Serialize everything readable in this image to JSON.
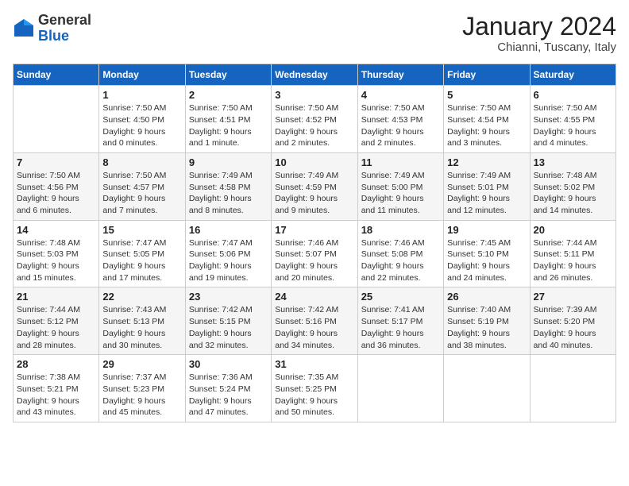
{
  "logo": {
    "general": "General",
    "blue": "Blue"
  },
  "header": {
    "month": "January 2024",
    "location": "Chianni, Tuscany, Italy"
  },
  "weekdays": [
    "Sunday",
    "Monday",
    "Tuesday",
    "Wednesday",
    "Thursday",
    "Friday",
    "Saturday"
  ],
  "weeks": [
    [
      {
        "day": "",
        "info": ""
      },
      {
        "day": "1",
        "info": "Sunrise: 7:50 AM\nSunset: 4:50 PM\nDaylight: 9 hours\nand 0 minutes."
      },
      {
        "day": "2",
        "info": "Sunrise: 7:50 AM\nSunset: 4:51 PM\nDaylight: 9 hours\nand 1 minute."
      },
      {
        "day": "3",
        "info": "Sunrise: 7:50 AM\nSunset: 4:52 PM\nDaylight: 9 hours\nand 2 minutes."
      },
      {
        "day": "4",
        "info": "Sunrise: 7:50 AM\nSunset: 4:53 PM\nDaylight: 9 hours\nand 2 minutes."
      },
      {
        "day": "5",
        "info": "Sunrise: 7:50 AM\nSunset: 4:54 PM\nDaylight: 9 hours\nand 3 minutes."
      },
      {
        "day": "6",
        "info": "Sunrise: 7:50 AM\nSunset: 4:55 PM\nDaylight: 9 hours\nand 4 minutes."
      }
    ],
    [
      {
        "day": "7",
        "info": "Sunrise: 7:50 AM\nSunset: 4:56 PM\nDaylight: 9 hours\nand 6 minutes."
      },
      {
        "day": "8",
        "info": "Sunrise: 7:50 AM\nSunset: 4:57 PM\nDaylight: 9 hours\nand 7 minutes."
      },
      {
        "day": "9",
        "info": "Sunrise: 7:49 AM\nSunset: 4:58 PM\nDaylight: 9 hours\nand 8 minutes."
      },
      {
        "day": "10",
        "info": "Sunrise: 7:49 AM\nSunset: 4:59 PM\nDaylight: 9 hours\nand 9 minutes."
      },
      {
        "day": "11",
        "info": "Sunrise: 7:49 AM\nSunset: 5:00 PM\nDaylight: 9 hours\nand 11 minutes."
      },
      {
        "day": "12",
        "info": "Sunrise: 7:49 AM\nSunset: 5:01 PM\nDaylight: 9 hours\nand 12 minutes."
      },
      {
        "day": "13",
        "info": "Sunrise: 7:48 AM\nSunset: 5:02 PM\nDaylight: 9 hours\nand 14 minutes."
      }
    ],
    [
      {
        "day": "14",
        "info": "Sunrise: 7:48 AM\nSunset: 5:03 PM\nDaylight: 9 hours\nand 15 minutes."
      },
      {
        "day": "15",
        "info": "Sunrise: 7:47 AM\nSunset: 5:05 PM\nDaylight: 9 hours\nand 17 minutes."
      },
      {
        "day": "16",
        "info": "Sunrise: 7:47 AM\nSunset: 5:06 PM\nDaylight: 9 hours\nand 19 minutes."
      },
      {
        "day": "17",
        "info": "Sunrise: 7:46 AM\nSunset: 5:07 PM\nDaylight: 9 hours\nand 20 minutes."
      },
      {
        "day": "18",
        "info": "Sunrise: 7:46 AM\nSunset: 5:08 PM\nDaylight: 9 hours\nand 22 minutes."
      },
      {
        "day": "19",
        "info": "Sunrise: 7:45 AM\nSunset: 5:10 PM\nDaylight: 9 hours\nand 24 minutes."
      },
      {
        "day": "20",
        "info": "Sunrise: 7:44 AM\nSunset: 5:11 PM\nDaylight: 9 hours\nand 26 minutes."
      }
    ],
    [
      {
        "day": "21",
        "info": "Sunrise: 7:44 AM\nSunset: 5:12 PM\nDaylight: 9 hours\nand 28 minutes."
      },
      {
        "day": "22",
        "info": "Sunrise: 7:43 AM\nSunset: 5:13 PM\nDaylight: 9 hours\nand 30 minutes."
      },
      {
        "day": "23",
        "info": "Sunrise: 7:42 AM\nSunset: 5:15 PM\nDaylight: 9 hours\nand 32 minutes."
      },
      {
        "day": "24",
        "info": "Sunrise: 7:42 AM\nSunset: 5:16 PM\nDaylight: 9 hours\nand 34 minutes."
      },
      {
        "day": "25",
        "info": "Sunrise: 7:41 AM\nSunset: 5:17 PM\nDaylight: 9 hours\nand 36 minutes."
      },
      {
        "day": "26",
        "info": "Sunrise: 7:40 AM\nSunset: 5:19 PM\nDaylight: 9 hours\nand 38 minutes."
      },
      {
        "day": "27",
        "info": "Sunrise: 7:39 AM\nSunset: 5:20 PM\nDaylight: 9 hours\nand 40 minutes."
      }
    ],
    [
      {
        "day": "28",
        "info": "Sunrise: 7:38 AM\nSunset: 5:21 PM\nDaylight: 9 hours\nand 43 minutes."
      },
      {
        "day": "29",
        "info": "Sunrise: 7:37 AM\nSunset: 5:23 PM\nDaylight: 9 hours\nand 45 minutes."
      },
      {
        "day": "30",
        "info": "Sunrise: 7:36 AM\nSunset: 5:24 PM\nDaylight: 9 hours\nand 47 minutes."
      },
      {
        "day": "31",
        "info": "Sunrise: 7:35 AM\nSunset: 5:25 PM\nDaylight: 9 hours\nand 50 minutes."
      },
      {
        "day": "",
        "info": ""
      },
      {
        "day": "",
        "info": ""
      },
      {
        "day": "",
        "info": ""
      }
    ]
  ]
}
